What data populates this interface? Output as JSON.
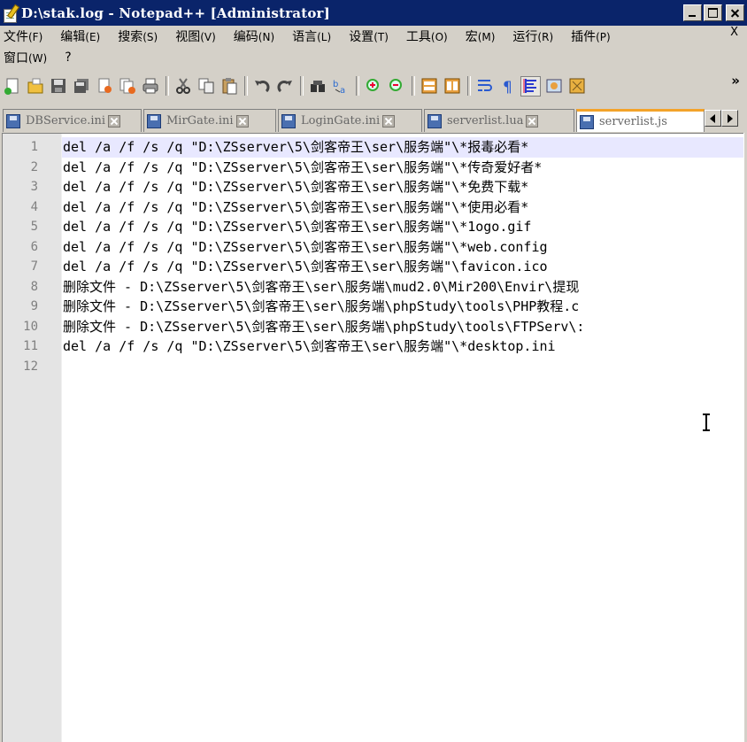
{
  "window": {
    "title": "D:\\stak.log - Notepad++ [Administrator]"
  },
  "menu": {
    "row1": [
      {
        "label": "文件",
        "acc": "(F)"
      },
      {
        "label": "编辑",
        "acc": "(E)"
      },
      {
        "label": "搜索",
        "acc": "(S)"
      },
      {
        "label": "视图",
        "acc": "(V)"
      },
      {
        "label": "编码",
        "acc": "(N)"
      },
      {
        "label": "语言",
        "acc": "(L)"
      },
      {
        "label": "设置",
        "acc": "(T)"
      },
      {
        "label": "工具",
        "acc": "(O)"
      },
      {
        "label": "宏",
        "acc": "(M)"
      },
      {
        "label": "运行",
        "acc": "(R)"
      },
      {
        "label": "插件",
        "acc": "(P)"
      }
    ],
    "row2": [
      {
        "label": "窗口",
        "acc": "(W)"
      },
      {
        "label": "?",
        "acc": ""
      }
    ],
    "close_doc": "X"
  },
  "toolbar": {
    "buttons": [
      "new-file-icon",
      "open-file-icon",
      "save-icon",
      "save-all-icon",
      "close-icon",
      "close-all-icon",
      "print-icon",
      "cut-icon",
      "copy-icon",
      "paste-icon",
      "undo-icon",
      "redo-icon",
      "find-icon",
      "replace-icon",
      "zoom-in-icon",
      "zoom-out-icon",
      "sync-vertical-icon",
      "sync-horizontal-icon",
      "word-wrap-icon",
      "show-all-chars-icon",
      "indent-guide-icon",
      "user-language-icon",
      "doc-map-icon"
    ],
    "more": "»"
  },
  "tabs": [
    {
      "label": "DBService.ini",
      "active": false
    },
    {
      "label": "MirGate.ini",
      "active": false
    },
    {
      "label": "LoginGate.ini",
      "active": false
    },
    {
      "label": "serverlist.lua",
      "active": false
    },
    {
      "label": "serverlist.js",
      "active": true
    }
  ],
  "editor": {
    "lines": [
      {
        "n": "1",
        "text": "del /a /f /s /q \"D:\\ZSserver\\5\\剑客帝王\\ser\\服务端\"\\*报毒必看*"
      },
      {
        "n": "2",
        "text": "del /a /f /s /q \"D:\\ZSserver\\5\\剑客帝王\\ser\\服务端\"\\*传奇爱好者*"
      },
      {
        "n": "3",
        "text": "del /a /f /s /q \"D:\\ZSserver\\5\\剑客帝王\\ser\\服务端\"\\*免费下载*"
      },
      {
        "n": "4",
        "text": "del /a /f /s /q \"D:\\ZSserver\\5\\剑客帝王\\ser\\服务端\"\\*使用必看*"
      },
      {
        "n": "5",
        "text": "del /a /f /s /q \"D:\\ZSserver\\5\\剑客帝王\\ser\\服务端\"\\*1ogo.gif"
      },
      {
        "n": "6",
        "text": "del /a /f /s /q \"D:\\ZSserver\\5\\剑客帝王\\ser\\服务端\"\\*web.config"
      },
      {
        "n": "7",
        "text": "del /a /f /s /q \"D:\\ZSserver\\5\\剑客帝王\\ser\\服务端\"\\favicon.ico"
      },
      {
        "n": "8",
        "text": "删除文件 - D:\\ZSserver\\5\\剑客帝王\\ser\\服务端\\mud2.0\\Mir200\\Envir\\提现"
      },
      {
        "n": "9",
        "text": "删除文件 - D:\\ZSserver\\5\\剑客帝王\\ser\\服务端\\phpStudy\\tools\\PHP教程.c"
      },
      {
        "n": "10",
        "text": "删除文件 - D:\\ZSserver\\5\\剑客帝王\\ser\\服务端\\phpStudy\\tools\\FTPServ\\:"
      },
      {
        "n": "11",
        "text": "del /a /f /s /q \"D:\\ZSserver\\5\\剑客帝王\\ser\\服务端\"\\*desktop.ini"
      },
      {
        "n": "12",
        "text": ""
      }
    ],
    "current_line": 1
  }
}
